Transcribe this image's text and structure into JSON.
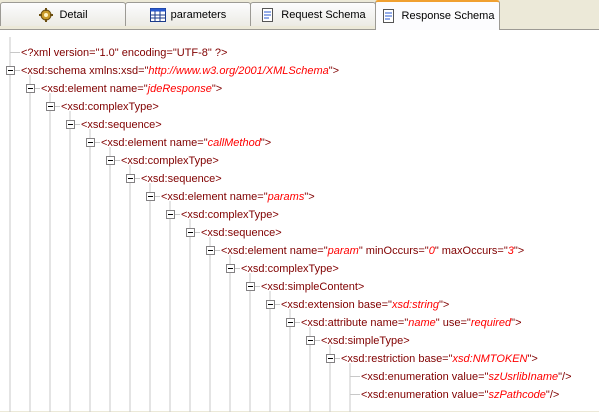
{
  "tabs": [
    {
      "label": "Detail",
      "icon": "gear-puzzle-icon",
      "active": false
    },
    {
      "label": "parameters",
      "icon": "table-icon",
      "active": false
    },
    {
      "label": "Request Schema",
      "icon": "schema-document-icon",
      "active": false
    },
    {
      "label": "Response Schema",
      "icon": "schema-document-icon",
      "active": true
    }
  ],
  "lines": [
    {
      "depth": 0,
      "expander": false,
      "parts": [
        [
          "tag",
          "<?xml version=\"1.0\" encoding=\"UTF-8\" ?>"
        ]
      ]
    },
    {
      "depth": 0,
      "expander": true,
      "parts": [
        [
          "tag",
          "<xsd:schema xmlns:xsd=\""
        ],
        [
          "val",
          "http://www.w3.org/2001/XMLSchema"
        ],
        [
          "tag",
          "\">"
        ]
      ]
    },
    {
      "depth": 1,
      "expander": true,
      "parts": [
        [
          "tag",
          "<xsd:element name=\""
        ],
        [
          "val",
          "jdeResponse"
        ],
        [
          "tag",
          "\">"
        ]
      ]
    },
    {
      "depth": 2,
      "expander": true,
      "parts": [
        [
          "tag",
          "<xsd:complexType>"
        ]
      ]
    },
    {
      "depth": 3,
      "expander": true,
      "parts": [
        [
          "tag",
          "<xsd:sequence>"
        ]
      ]
    },
    {
      "depth": 4,
      "expander": true,
      "parts": [
        [
          "tag",
          "<xsd:element name=\""
        ],
        [
          "val",
          "callMethod"
        ],
        [
          "tag",
          "\">"
        ]
      ]
    },
    {
      "depth": 5,
      "expander": true,
      "parts": [
        [
          "tag",
          "<xsd:complexType>"
        ]
      ]
    },
    {
      "depth": 6,
      "expander": true,
      "parts": [
        [
          "tag",
          "<xsd:sequence>"
        ]
      ]
    },
    {
      "depth": 7,
      "expander": true,
      "parts": [
        [
          "tag",
          "<xsd:element name=\""
        ],
        [
          "val",
          "params"
        ],
        [
          "tag",
          "\">"
        ]
      ]
    },
    {
      "depth": 8,
      "expander": true,
      "parts": [
        [
          "tag",
          "<xsd:complexType>"
        ]
      ]
    },
    {
      "depth": 9,
      "expander": true,
      "parts": [
        [
          "tag",
          "<xsd:sequence>"
        ]
      ]
    },
    {
      "depth": 10,
      "expander": true,
      "parts": [
        [
          "tag",
          "<xsd:element name=\""
        ],
        [
          "val",
          "param"
        ],
        [
          "tag",
          "\" minOccurs=\""
        ],
        [
          "val",
          "0"
        ],
        [
          "tag",
          "\" maxOccurs=\""
        ],
        [
          "val",
          "3"
        ],
        [
          "tag",
          "\">"
        ]
      ]
    },
    {
      "depth": 11,
      "expander": true,
      "parts": [
        [
          "tag",
          "<xsd:complexType>"
        ]
      ]
    },
    {
      "depth": 12,
      "expander": true,
      "parts": [
        [
          "tag",
          "<xsd:simpleContent>"
        ]
      ]
    },
    {
      "depth": 13,
      "expander": true,
      "parts": [
        [
          "tag",
          "<xsd:extension base=\""
        ],
        [
          "val",
          "xsd:string"
        ],
        [
          "tag",
          "\">"
        ]
      ]
    },
    {
      "depth": 14,
      "expander": true,
      "parts": [
        [
          "tag",
          "<xsd:attribute name=\""
        ],
        [
          "val",
          "name"
        ],
        [
          "tag",
          "\" use=\""
        ],
        [
          "val",
          "required"
        ],
        [
          "tag",
          "\">"
        ]
      ]
    },
    {
      "depth": 15,
      "expander": true,
      "parts": [
        [
          "tag",
          "<xsd:simpleType>"
        ]
      ]
    },
    {
      "depth": 16,
      "expander": true,
      "parts": [
        [
          "tag",
          "<xsd:restriction base=\""
        ],
        [
          "val",
          "xsd:NMTOKEN"
        ],
        [
          "tag",
          "\">"
        ]
      ]
    },
    {
      "depth": 17,
      "expander": false,
      "parts": [
        [
          "tag",
          "<xsd:enumeration value=\""
        ],
        [
          "val",
          "szUsrlibIname"
        ],
        [
          "tag",
          "\"/>"
        ]
      ]
    },
    {
      "depth": 17,
      "expander": false,
      "parts": [
        [
          "tag",
          "<xsd:enumeration value=\""
        ],
        [
          "val",
          "szPathcode"
        ],
        [
          "tag",
          "\"/>"
        ]
      ]
    }
  ],
  "colors": {
    "tag": "#800000",
    "value": "#ff0000",
    "guide": "#c8c8c8",
    "active_tab_accent": "#f0a030"
  }
}
